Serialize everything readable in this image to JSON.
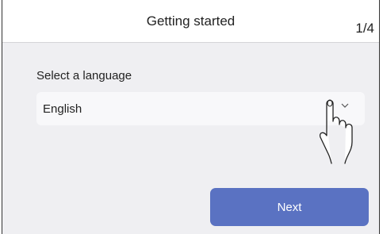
{
  "header": {
    "title": "Getting started",
    "step": "1/4"
  },
  "language": {
    "label": "Select a language",
    "selected": "English"
  },
  "actions": {
    "next_label": "Next"
  },
  "icons": {
    "dropdown": "chevron-down-icon",
    "pointer": "hand-pointer-icon"
  },
  "colors": {
    "background": "#efeff2",
    "primary_button": "#5a72c2"
  }
}
